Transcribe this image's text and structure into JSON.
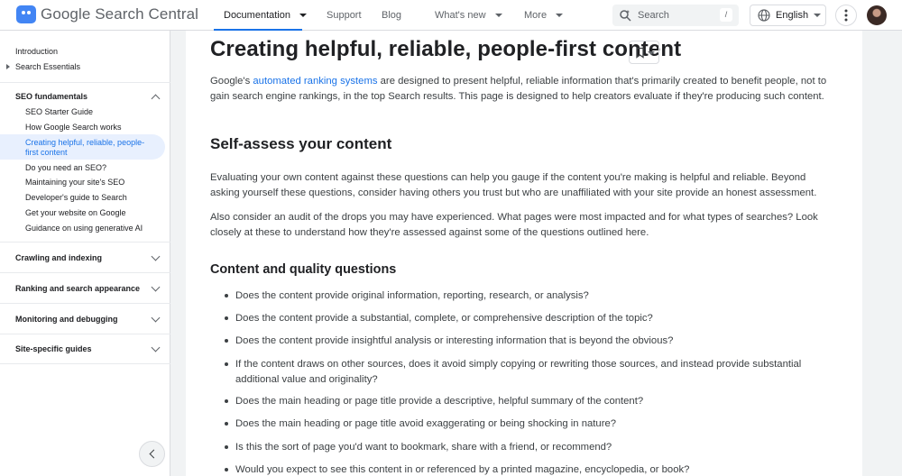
{
  "header": {
    "logo_text": "Google Search Central",
    "nav": [
      {
        "label": "Documentation",
        "active": true,
        "has_dropdown": true
      },
      {
        "label": "Support"
      },
      {
        "label": "Blog"
      },
      {
        "label": "What's new",
        "has_dropdown": true
      },
      {
        "label": "More",
        "has_dropdown": true
      }
    ],
    "search_placeholder": "Search",
    "search_shortcut": "/",
    "language": "English"
  },
  "sidebar": {
    "top_items": [
      "Introduction",
      "Search Essentials"
    ],
    "sections": [
      {
        "title": "SEO fundamentals",
        "expanded": true,
        "items": [
          "SEO Starter Guide",
          "How Google Search works",
          "Creating helpful, reliable, people-first content",
          "Do you need an SEO?",
          "Maintaining your site's SEO",
          "Developer's guide to Search",
          "Get your website on Google",
          "Guidance on using generative AI"
        ]
      },
      {
        "title": "Crawling and indexing",
        "expanded": false
      },
      {
        "title": "Ranking and search appearance",
        "expanded": false
      },
      {
        "title": "Monitoring and debugging",
        "expanded": false
      },
      {
        "title": "Site-specific guides",
        "expanded": false
      }
    ],
    "active_item_line1": "Creating helpful, reliable, people-",
    "active_item_line2": "first content"
  },
  "main": {
    "title": "Creating helpful, reliable, people-first content",
    "intro_before": "Google's ",
    "intro_link": "automated ranking systems",
    "intro_after": " are designed to present helpful, reliable information that's primarily created to benefit people, not to gain search engine rankings, in the top Search results. This page is designed to help creators evaluate if they're producing such content.",
    "section_title": "Self-assess your content",
    "para1": "Evaluating your own content against these questions can help you gauge if the content you're making is helpful and reliable. Beyond asking yourself these questions, consider having others you trust but who are unaffiliated with your site provide an honest assessment.",
    "para2": "Also consider an audit of the drops you may have experienced. What pages were most impacted and for what types of searches? Look closely at these to understand how they're assessed against some of the questions outlined here.",
    "subsection_title": "Content and quality questions",
    "questions": [
      "Does the content provide original information, reporting, research, or analysis?",
      "Does the content provide a substantial, complete, or comprehensive description of the topic?",
      "Does the content provide insightful analysis or interesting information that is beyond the obvious?",
      "If the content draws on other sources, does it avoid simply copying or rewriting those sources, and instead provide substantial additional value and originality?",
      "Does the main heading or page title provide a descriptive, helpful summary of the content?",
      "Does the main heading or page title avoid exaggerating or being shocking in nature?",
      "Is this the sort of page you'd want to bookmark, share with a friend, or recommend?",
      "Would you expect to see this content in or referenced by a printed magazine, encyclopedia, or book?"
    ]
  },
  "colors": {
    "accent": "#1a73e8",
    "active_bg": "#e8f0fe",
    "logo": "#4285f4"
  }
}
